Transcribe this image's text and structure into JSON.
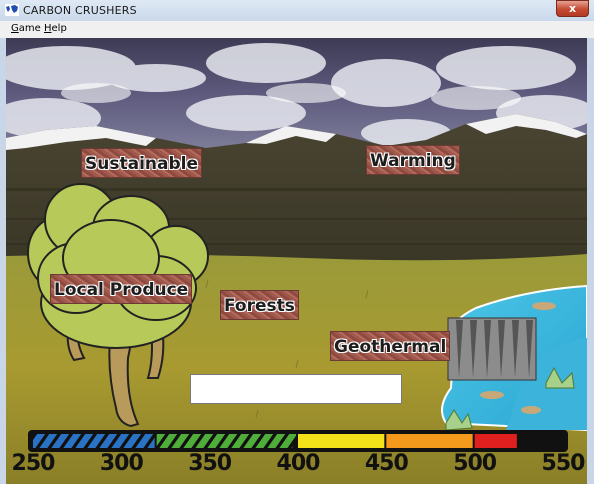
{
  "window": {
    "title": "CARBON CRUSHERS",
    "close_glyph": "x"
  },
  "menu": [
    {
      "label": "Game",
      "accel": "G"
    },
    {
      "label": "Help",
      "accel": "H"
    }
  ],
  "words": [
    {
      "text": "Sustainable"
    },
    {
      "text": "Warming"
    },
    {
      "text": "Local Produce"
    },
    {
      "text": "Forests"
    },
    {
      "text": "Geothermal"
    }
  ],
  "answer_input": {
    "value": ""
  },
  "meter": {
    "min": 250,
    "max": 550,
    "current": 400,
    "tick_labels": [
      "250",
      "300",
      "350",
      "400",
      "450",
      "500",
      "550"
    ],
    "segments": [
      {
        "from": 250,
        "to": 320,
        "color": "#2a73c4",
        "pattern": "striped"
      },
      {
        "from": 320,
        "to": 400,
        "color": "#4fae3a",
        "pattern": "striped"
      },
      {
        "from": 400,
        "to": 450,
        "color": "#f3e21a"
      },
      {
        "from": 450,
        "to": 500,
        "color": "#f39a1c"
      },
      {
        "from": 500,
        "to": 525,
        "color": "#e0201f"
      },
      {
        "from": 525,
        "to": 550,
        "color": "#111111"
      }
    ]
  },
  "icons": {
    "app": "world-map-icon",
    "close": "close-icon"
  }
}
